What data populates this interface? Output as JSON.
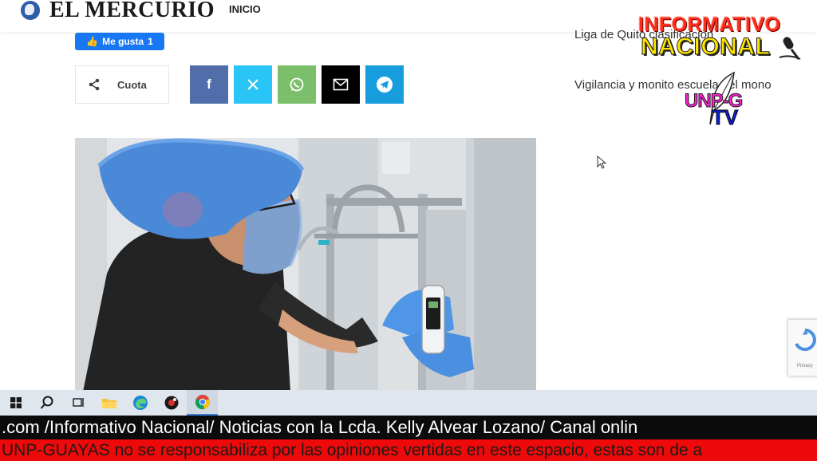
{
  "header": {
    "logo_text": "EL MERCURIO",
    "nav_home": "INICIO"
  },
  "like": {
    "label": "Me gusta",
    "count": "1"
  },
  "share": {
    "label": "Cuota",
    "icons": [
      "share-icon",
      "facebook-icon",
      "x-icon",
      "whatsapp-icon",
      "email-icon",
      "telegram-icon"
    ],
    "colors": {
      "facebook": "#516eab",
      "x": "#29c5f6",
      "whatsapp": "#7bbf6a",
      "email": "#000000",
      "telegram": "#179cde"
    }
  },
  "sidebar": {
    "links": [
      {
        "text": "Liga de Quito clasificación"
      },
      {
        "text": "Vigilancia y monito escuela del mono"
      }
    ]
  },
  "overlay": {
    "line1": "INFORMATIVO",
    "line2": "NACIONAL",
    "badge_top": "UNP-G",
    "badge_bottom": "TV"
  },
  "taskbar": {
    "icons": [
      "windows-start-icon",
      "search-icon",
      "task-view-icon",
      "file-explorer-icon",
      "edge-browser-icon",
      "app-icon",
      "chrome-icon"
    ]
  },
  "ticker": {
    "top": ".com /Informativo Nacional/ Noticias con la Lcda. Kelly Alvear Lozano/ Canal onlin",
    "bottom": "UNP-GUAYAS no se responsabiliza por las opiniones vertidas en este espacio, estas son de a"
  },
  "recaptcha": {
    "text": "Privacy"
  }
}
